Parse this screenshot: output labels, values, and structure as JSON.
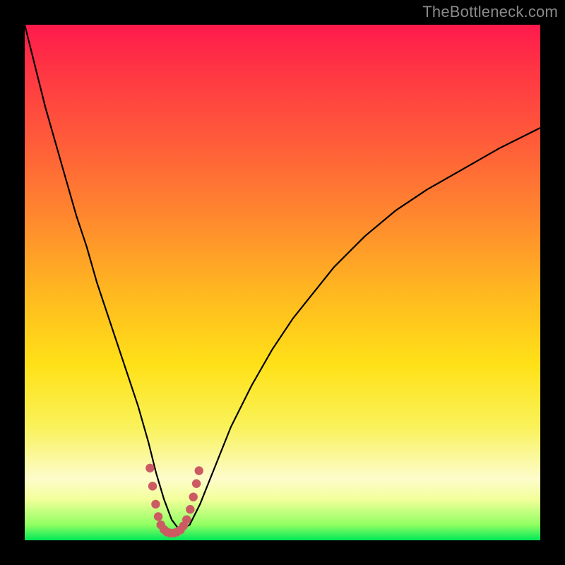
{
  "watermark": "TheBottleneck.com",
  "chart_data": {
    "type": "line",
    "title": "",
    "xlabel": "",
    "ylabel": "",
    "xlim": [
      0,
      100
    ],
    "ylim": [
      0,
      100
    ],
    "gradient_stops": [
      {
        "pos": 0,
        "color": "#ff1a4d"
      },
      {
        "pos": 8,
        "color": "#ff3344"
      },
      {
        "pos": 22,
        "color": "#ff5a3a"
      },
      {
        "pos": 38,
        "color": "#ff8a2e"
      },
      {
        "pos": 52,
        "color": "#ffb820"
      },
      {
        "pos": 66,
        "color": "#ffe118"
      },
      {
        "pos": 78,
        "color": "#f9f25a"
      },
      {
        "pos": 88,
        "color": "#fdfccb"
      },
      {
        "pos": 92,
        "color": "#f3ff9b"
      },
      {
        "pos": 97,
        "color": "#90ff62"
      },
      {
        "pos": 100,
        "color": "#00e858"
      }
    ],
    "series": [
      {
        "name": "bottleneck-curve",
        "x": [
          0,
          2,
          4,
          6,
          8,
          10,
          12,
          14,
          16,
          18,
          20,
          22,
          24,
          25.5,
          27,
          28.5,
          30,
          32,
          34,
          36,
          38,
          40,
          44,
          48,
          52,
          56,
          60,
          66,
          72,
          78,
          85,
          92,
          100
        ],
        "y": [
          100,
          92,
          84,
          77,
          70,
          63,
          57,
          50,
          44,
          38,
          32,
          26,
          19,
          13,
          8,
          4,
          2,
          3,
          7,
          12,
          17,
          22,
          30,
          37,
          43,
          48,
          53,
          59,
          64,
          68,
          72,
          76,
          80
        ]
      }
    ],
    "markers": {
      "name": "flat-bottom-dots",
      "color": "#cc5a63",
      "points": [
        {
          "x": 24.3,
          "y": 14.0
        },
        {
          "x": 24.8,
          "y": 10.5
        },
        {
          "x": 25.4,
          "y": 7.0
        },
        {
          "x": 25.9,
          "y": 4.6
        },
        {
          "x": 26.4,
          "y": 3.0
        },
        {
          "x": 27.0,
          "y": 2.1
        },
        {
          "x": 27.6,
          "y": 1.6
        },
        {
          "x": 28.2,
          "y": 1.4
        },
        {
          "x": 28.9,
          "y": 1.4
        },
        {
          "x": 29.5,
          "y": 1.6
        },
        {
          "x": 30.2,
          "y": 2.0
        },
        {
          "x": 30.8,
          "y": 2.8
        },
        {
          "x": 31.4,
          "y": 4.0
        },
        {
          "x": 32.1,
          "y": 6.0
        },
        {
          "x": 32.7,
          "y": 8.4
        },
        {
          "x": 33.3,
          "y": 11.0
        },
        {
          "x": 33.8,
          "y": 13.5
        }
      ]
    }
  }
}
